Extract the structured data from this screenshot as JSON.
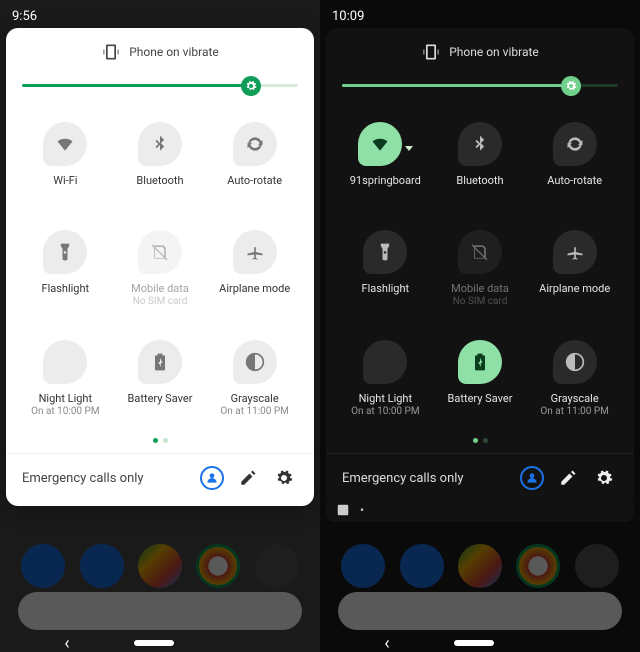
{
  "left": {
    "theme": "light",
    "clock": "9:56",
    "vibrate_label": "Phone on vibrate",
    "brightness": 0.83,
    "tiles": [
      {
        "id": "wifi",
        "label": "Wi-Fi",
        "sub": "",
        "active": false
      },
      {
        "id": "bluetooth",
        "label": "Bluetooth",
        "sub": "",
        "active": false
      },
      {
        "id": "autorotate",
        "label": "Auto-rotate",
        "sub": "",
        "active": false
      },
      {
        "id": "flashlight",
        "label": "Flashlight",
        "sub": "",
        "active": false
      },
      {
        "id": "mobiledata",
        "label": "Mobile data",
        "sub": "No SIM card",
        "disabled": true
      },
      {
        "id": "airplane",
        "label": "Airplane mode",
        "sub": "",
        "active": false
      },
      {
        "id": "nightlight",
        "label": "Night Light",
        "sub": "On at 10:00 PM",
        "active": false
      },
      {
        "id": "battery",
        "label": "Battery Saver",
        "sub": "",
        "active": false
      },
      {
        "id": "grayscale",
        "label": "Grayscale",
        "sub": "On at 11:00 PM",
        "active": false
      }
    ],
    "pages": {
      "count": 2,
      "current": 0
    },
    "footer": {
      "network": "Emergency calls only"
    }
  },
  "right": {
    "theme": "dark",
    "clock": "10:09",
    "vibrate_label": "Phone on vibrate",
    "brightness": 0.83,
    "tiles": [
      {
        "id": "wifi",
        "label": "91springboard",
        "sub": "",
        "active": true,
        "expand": true
      },
      {
        "id": "bluetooth",
        "label": "Bluetooth",
        "sub": "",
        "active": false
      },
      {
        "id": "autorotate",
        "label": "Auto-rotate",
        "sub": "",
        "active": false
      },
      {
        "id": "flashlight",
        "label": "Flashlight",
        "sub": "",
        "active": false
      },
      {
        "id": "mobiledata",
        "label": "Mobile data",
        "sub": "No SIM card",
        "disabled": true
      },
      {
        "id": "airplane",
        "label": "Airplane mode",
        "sub": "",
        "active": false
      },
      {
        "id": "nightlight",
        "label": "Night Light",
        "sub": "On at 10:00 PM",
        "active": false
      },
      {
        "id": "battery",
        "label": "Battery Saver",
        "sub": "",
        "active": true
      },
      {
        "id": "grayscale",
        "label": "Grayscale",
        "sub": "On at 11:00 PM",
        "active": false
      }
    ],
    "pages": {
      "count": 2,
      "current": 0
    },
    "footer": {
      "network": "Emergency calls only"
    }
  },
  "icons": {
    "wifi": "wifi-icon",
    "bluetooth": "bluetooth-icon",
    "autorotate": "auto-rotate-icon",
    "flashlight": "flashlight-icon",
    "mobiledata": "sim-off-icon",
    "airplane": "airplane-icon",
    "nightlight": "night-light-icon",
    "battery": "battery-saver-icon",
    "grayscale": "grayscale-icon"
  },
  "nav": {
    "back": "‹",
    "home": "⬭"
  },
  "accent_light": "#0f9d58",
  "accent_dark": "#71d08c"
}
